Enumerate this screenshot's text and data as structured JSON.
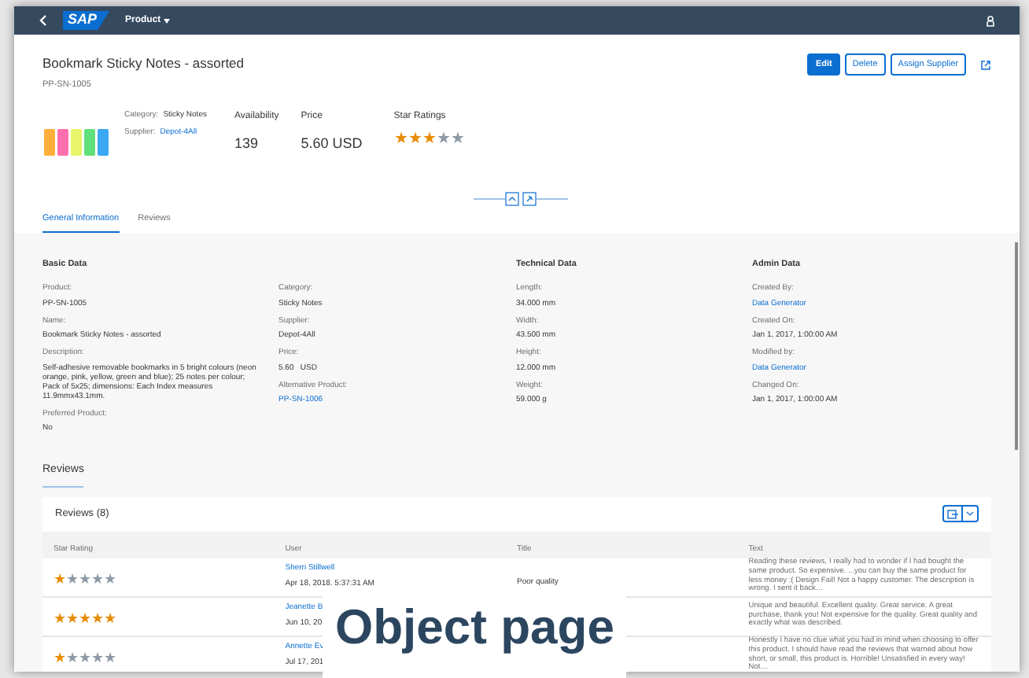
{
  "shell": {
    "logo": "SAP",
    "title": "Product"
  },
  "header": {
    "title": "Bookmark Sticky Notes - assorted",
    "subtitle": "PP-SN-1005",
    "actions": [
      {
        "label": "Edit",
        "kind": "emphasized"
      },
      {
        "label": "Delete",
        "kind": "default"
      },
      {
        "label": "Assign Supplier",
        "kind": "default"
      }
    ],
    "attributes": [
      {
        "label": "Category:",
        "value": "Sticky Notes",
        "link": false
      },
      {
        "label": "Supplier:",
        "value": "Depot-4All",
        "link": true
      }
    ],
    "kpis": [
      {
        "label": "Availability",
        "value": "139"
      },
      {
        "label": "Price",
        "value": "5.60 USD"
      }
    ],
    "rating": {
      "label": "Star Ratings",
      "stars": 3
    }
  },
  "tabs": [
    {
      "label": "General Information",
      "selected": true
    },
    {
      "label": "Reviews",
      "selected": false
    }
  ],
  "sections": [
    {
      "title": "Basic Data",
      "columns": [
        [
          {
            "label": "Product:",
            "value": "PP-SN-1005",
            "link": false
          },
          {
            "label": "Name:",
            "value": "Bookmark Sticky Notes - assorted",
            "link": false
          },
          {
            "label": "Description:",
            "value": "Self-adhesive removable bookmarks in 5 bright colours (neon orange, pink, yellow, green and blue); 25 notes per colour; Pack of 5x25; dimensions: Each Index measures 11.9mmx43.1mm.",
            "link": false
          },
          {
            "label": "Preferred Product:",
            "value": "No",
            "link": false
          }
        ],
        [
          {
            "label": "Category:",
            "value": "Sticky Notes",
            "link": false
          },
          {
            "label": "Supplier:",
            "value": "Depot-4All",
            "link": false
          },
          {
            "label": "Price:",
            "value": "5.60   USD",
            "link": false
          },
          {
            "label": "Alternative Product:",
            "value": "PP-SN-1006",
            "link": true
          }
        ]
      ]
    },
    {
      "title": "Technical Data",
      "columns": [
        [
          {
            "label": "Length:",
            "value": "34.000 mm",
            "link": false
          },
          {
            "label": "Width:",
            "value": "43.500 mm",
            "link": false
          },
          {
            "label": "Height:",
            "value": "12.000 mm",
            "link": false
          },
          {
            "label": "Weight:",
            "value": "59.000 g",
            "link": false
          }
        ]
      ]
    },
    {
      "title": "Admin Data",
      "columns": [
        [
          {
            "label": "Created By:",
            "value": "Data Generator",
            "link": true
          },
          {
            "label": "Created On:",
            "value": "Jan 1, 2017, 1:00:00 AM",
            "link": false
          },
          {
            "label": "Modified by:",
            "value": "Data Generator",
            "link": true
          },
          {
            "label": "Changed On:",
            "value": "Jan 1, 2017, 1:00:00 AM",
            "link": false
          }
        ]
      ]
    }
  ],
  "reviews": {
    "heading": "Reviews",
    "table_title": "Reviews (8)",
    "columns": [
      "Star Rating",
      "User",
      "Title",
      "Text"
    ],
    "rows": [
      {
        "stars": 1,
        "user": "Sherri Stillwell",
        "date": "Apr 18, 2018, 5:37:31 AM",
        "title": "Poor quality",
        "text": "Reading these reviews, I really had to wonder if I had bought the same product. So expensive. ...you can buy the same product for less money :( Design Fail! Not a happy customer. The description is wrong. I sent it back…"
      },
      {
        "stars": 5,
        "user": "Jeanette B",
        "date": "Jun 10, 20",
        "text": "Unique and beautiful. Excellent quality. Great service. A great purchase, thank you! Not expensive for the quality. Great quality and exactly what was described."
      },
      {
        "stars": 1,
        "user": "Annette Ev",
        "date": "Jul 17, 201",
        "text": "Honestly I have no clue what you had in mind when choosing to offer this product. I should have read the reviews that warned about how short, or small, this product is. Horrible! Unsatisfied in every way! Not…"
      }
    ]
  },
  "caption": "Object page"
}
